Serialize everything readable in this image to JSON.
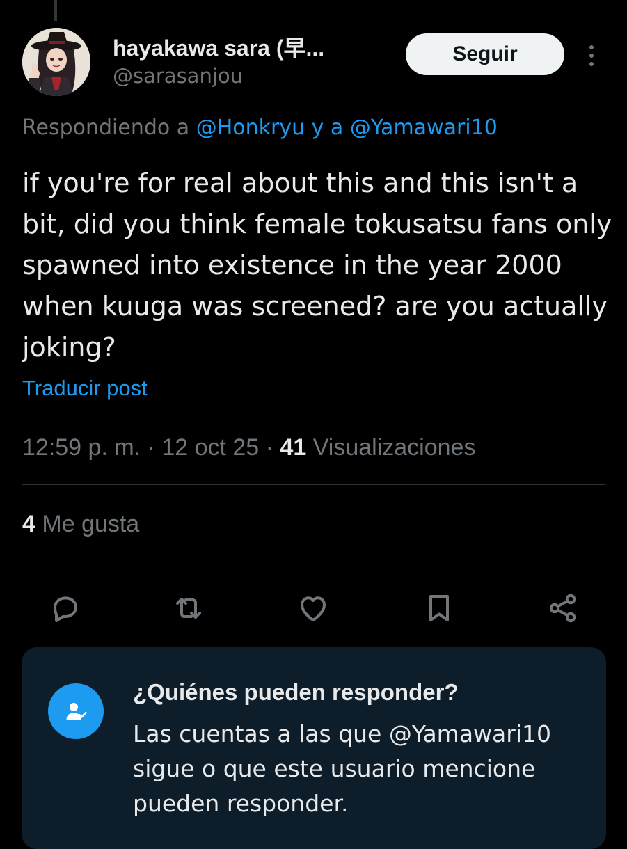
{
  "author": {
    "display_name": "hayakawa sara (早...",
    "handle": "@sarasanjou",
    "avatar_icon": "profile-avatar"
  },
  "header": {
    "follow_label": "Seguir",
    "more_icon": "more-vertical-icon"
  },
  "reply": {
    "prefix": "Respondiendo a ",
    "mention1": "@Honkryu",
    "connector": " y a ",
    "mention2": "@Yamawari10"
  },
  "tweet": {
    "text": "if you're for real about this and this isn't a bit, did you think female tokusatsu fans only spawned into existence in the year 2000 when kuuga was screened? are you actually joking?",
    "translate_label": "Traducir post"
  },
  "meta": {
    "time": "12:59 p. m.",
    "sep": " · ",
    "date": "12 oct 25",
    "views_count": "41",
    "views_label": " Visualizaciones"
  },
  "stats": {
    "likes_count": "4",
    "likes_label": " Me gusta"
  },
  "actions": [
    {
      "name": "reply-icon"
    },
    {
      "name": "repost-icon"
    },
    {
      "name": "like-icon"
    },
    {
      "name": "bookmark-icon"
    },
    {
      "name": "share-icon"
    }
  ],
  "who_can_reply": {
    "title": "¿Quiénes pueden responder?",
    "body": "Las cuentas a las que @Yamawari10 sigue o que este usuario mencione pueden responder.",
    "icon": "user-check-icon"
  },
  "colors": {
    "background": "#000000",
    "text": "#e7e9ea",
    "secondary": "#71767b",
    "accent": "#1d9bf0",
    "card": "#0d1d2a",
    "divider": "#2f3336"
  }
}
